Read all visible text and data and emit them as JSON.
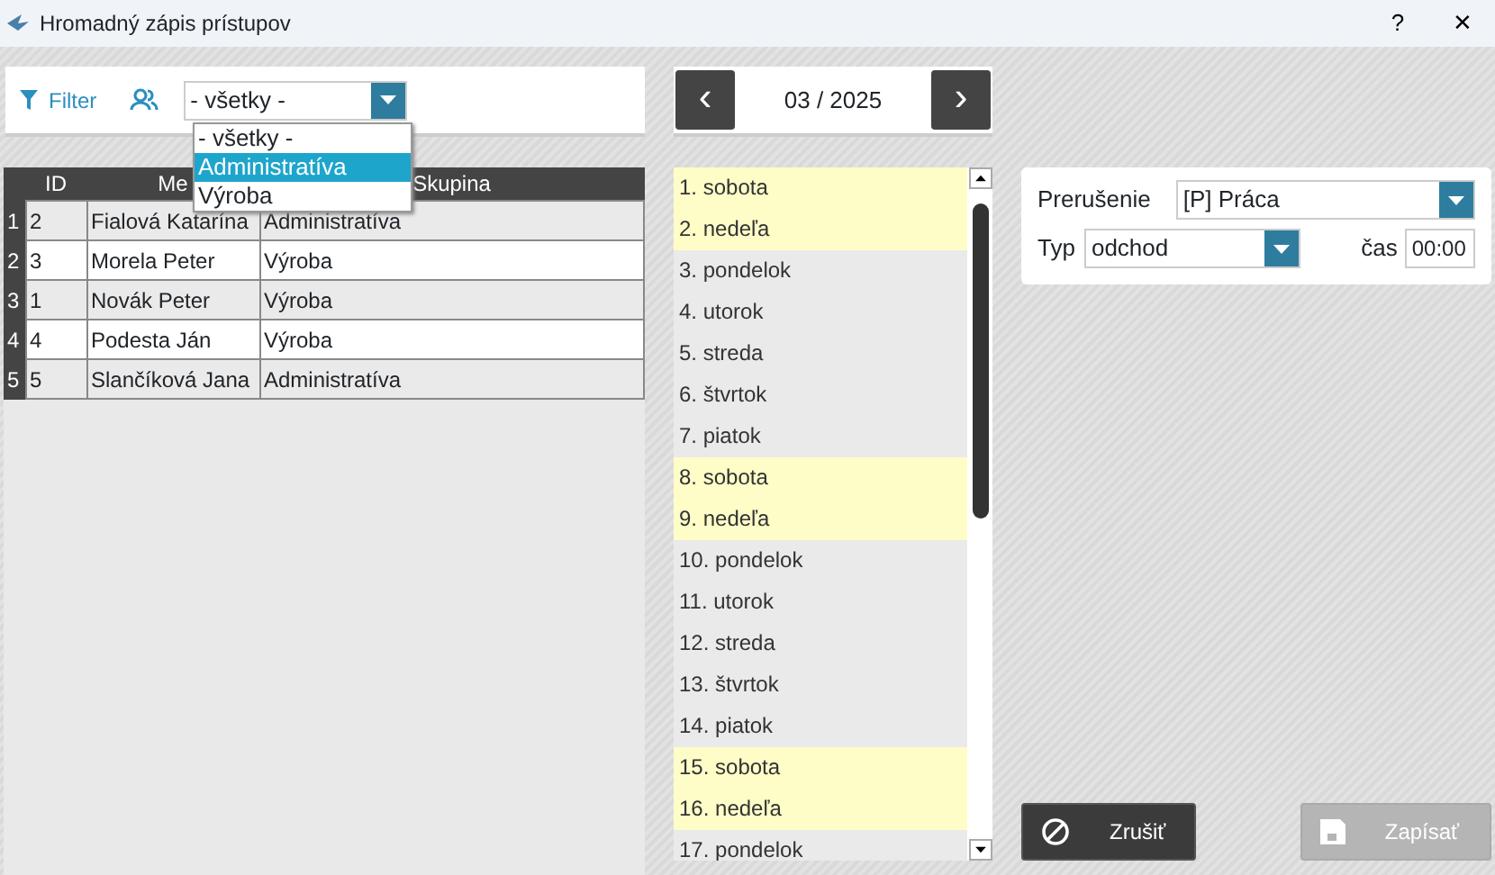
{
  "window": {
    "title": "Hromadný zápis prístupov",
    "help": "?",
    "close": "✕"
  },
  "filter": {
    "label": "Filter",
    "group_select": {
      "value": "- všetky -",
      "open": true,
      "options": [
        {
          "label": "- všetky -",
          "highlighted": false
        },
        {
          "label": "Administratíva",
          "highlighted": true
        },
        {
          "label": "Výroba",
          "highlighted": false
        }
      ]
    }
  },
  "table": {
    "columns": [
      "ID",
      "Me",
      "Skupina"
    ],
    "rows": [
      {
        "num": "1",
        "cells": [
          "2",
          "Fialová Katarína",
          "Administratíva"
        ]
      },
      {
        "num": "2",
        "cells": [
          "3",
          "Morela Peter",
          "Výroba"
        ]
      },
      {
        "num": "3",
        "cells": [
          "1",
          "Novák Peter",
          "Výroba"
        ]
      },
      {
        "num": "4",
        "cells": [
          "4",
          "Podesta Ján",
          "Výroba"
        ]
      },
      {
        "num": "5",
        "cells": [
          "5",
          "Slančíková Jana",
          "Administratíva"
        ]
      }
    ]
  },
  "month": {
    "prev": "‹",
    "label": "03 / 2025",
    "next": "›"
  },
  "days": [
    {
      "label": "1. sobota",
      "weekend": true
    },
    {
      "label": "2. nedeľa",
      "weekend": true
    },
    {
      "label": "3. pondelok",
      "weekend": false
    },
    {
      "label": "4. utorok",
      "weekend": false
    },
    {
      "label": "5. streda",
      "weekend": false
    },
    {
      "label": "6. štvrtok",
      "weekend": false
    },
    {
      "label": "7. piatok",
      "weekend": false
    },
    {
      "label": "8. sobota",
      "weekend": true
    },
    {
      "label": "9. nedeľa",
      "weekend": true
    },
    {
      "label": "10. pondelok",
      "weekend": false
    },
    {
      "label": "11. utorok",
      "weekend": false
    },
    {
      "label": "12. streda",
      "weekend": false
    },
    {
      "label": "13. štvrtok",
      "weekend": false
    },
    {
      "label": "14. piatok",
      "weekend": false
    },
    {
      "label": "15. sobota",
      "weekend": true
    },
    {
      "label": "16. nedeľa",
      "weekend": true
    },
    {
      "label": "17. pondelok",
      "weekend": false
    }
  ],
  "form": {
    "interruption_label": "Prerušenie",
    "interruption": "[P] Práca",
    "type_label": "Typ",
    "type": "odchod",
    "time_label": "čas",
    "time": "00:00"
  },
  "buttons": [
    {
      "label": "Zrušiť",
      "kind": "cancel",
      "disabled": false
    },
    {
      "label": "Zapísať",
      "kind": "save",
      "disabled": true
    }
  ]
}
